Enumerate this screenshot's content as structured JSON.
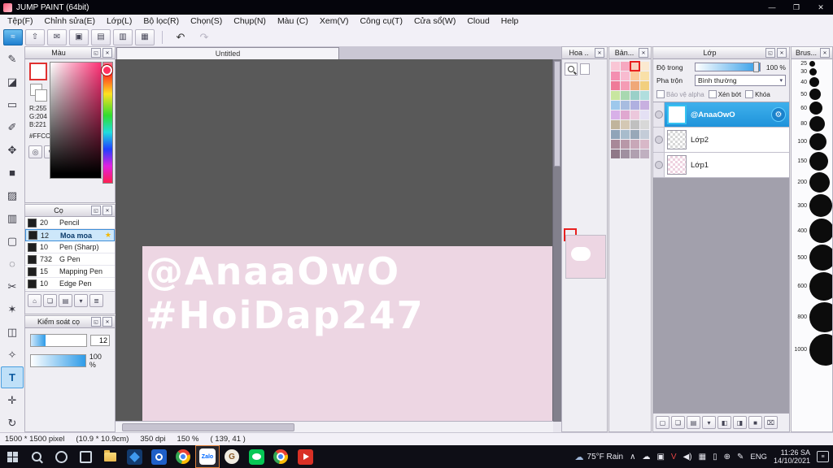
{
  "window": {
    "title": "JUMP PAINT (64bit)",
    "minimize_glyph": "—",
    "maximize_glyph": "❐",
    "close_glyph": "✕"
  },
  "ui": {
    "detach_glyph": "◱",
    "close_glyph": "✕",
    "dropdown_glyph": "▾",
    "accent_blue": "#2F9CE8",
    "selection_red": "#E82020"
  },
  "menubar": {
    "items": [
      {
        "label": "Tệp(F)",
        "name": "tep"
      },
      {
        "label": "Chỉnh sửa(E)",
        "name": "chinh-sua"
      },
      {
        "label": "Lớp(L)",
        "name": "lop"
      },
      {
        "label": "Bộ lọc(R)",
        "name": "bo-loc"
      },
      {
        "label": "Chọn(S)",
        "name": "chon"
      },
      {
        "label": "Chụp(N)",
        "name": "chup"
      },
      {
        "label": "Màu (C)",
        "name": "mau"
      },
      {
        "label": "Xem(V)",
        "name": "xem"
      },
      {
        "label": "Công cụ(T)",
        "name": "cong-cu"
      },
      {
        "label": "Cửa sổ(W)",
        "name": "cua-so"
      },
      {
        "label": "Cloud",
        "name": "cloud"
      },
      {
        "label": "Help",
        "name": "help"
      }
    ]
  },
  "toolbar": {
    "buttons": [
      {
        "name": "paint-mode-button",
        "glyph": "≈",
        "accent": true
      },
      {
        "name": "export-button",
        "glyph": "⇧"
      },
      {
        "name": "comment-button",
        "glyph": "✉"
      },
      {
        "name": "screen-share-button",
        "glyph": "▣"
      },
      {
        "name": "page-button",
        "glyph": "▤"
      },
      {
        "name": "pages-button",
        "glyph": "▥"
      },
      {
        "name": "grid-button",
        "glyph": "▦"
      }
    ],
    "undo_glyph": "↶",
    "redo_glyph": "↷"
  },
  "tools": {
    "items": [
      {
        "name": "pen-tool",
        "glyph": "✎"
      },
      {
        "name": "eraser-tool",
        "glyph": "◪"
      },
      {
        "name": "rect-tool",
        "glyph": "▭"
      },
      {
        "name": "dip-pen-tool",
        "glyph": "✐"
      },
      {
        "name": "move-tool",
        "glyph": "✥"
      },
      {
        "name": "fill-square-tool",
        "glyph": "■"
      },
      {
        "name": "bucket-tool",
        "glyph": "▨"
      },
      {
        "name": "gradient-tool",
        "glyph": "▥"
      },
      {
        "name": "select-rect-tool",
        "glyph": "▢"
      },
      {
        "name": "select-ellipse-tool",
        "glyph": "◌"
      },
      {
        "name": "lasso-tool",
        "glyph": "✂"
      },
      {
        "name": "magic-wand-tool",
        "glyph": "✶"
      },
      {
        "name": "divide-tool",
        "glyph": "◫"
      },
      {
        "name": "eyedropper-tool",
        "glyph": "✧"
      },
      {
        "name": "text-tool",
        "glyph": "T",
        "selected": true
      },
      {
        "name": "hand-tool",
        "glyph": "✛"
      },
      {
        "name": "rotate-tool",
        "glyph": "↻"
      }
    ]
  },
  "color_panel": {
    "title": "Màu",
    "r_label": "R:255",
    "g_label": "G:204",
    "b_label": "B:221",
    "hex": "#FFCCDD",
    "buttons": [
      {
        "name": "color-wheel-button",
        "glyph": "◎"
      },
      {
        "name": "color-history-button",
        "glyph": "↖"
      }
    ]
  },
  "brush_panel": {
    "title": "Cọ",
    "selected_star_glyph": "★",
    "brushes": [
      {
        "size": "20",
        "name": "Pencil"
      },
      {
        "size": "12",
        "name": "Moa moa",
        "selected": true
      },
      {
        "size": "10",
        "name": "Pen (Sharp)"
      },
      {
        "size": "732",
        "name": "G Pen"
      },
      {
        "size": "15",
        "name": "Mapping Pen"
      },
      {
        "size": "10",
        "name": "Edge Pen"
      }
    ],
    "buttons": [
      {
        "name": "brush-home-button",
        "glyph": "⌂"
      },
      {
        "name": "brush-new-button",
        "glyph": "❏"
      },
      {
        "name": "brush-folder-button",
        "glyph": "▤"
      },
      {
        "name": "brush-menu-button",
        "glyph": "▾"
      },
      {
        "name": "brush-list-button",
        "glyph": "≣"
      }
    ]
  },
  "brush_control_panel": {
    "title": "Kiểm soát cọ",
    "size_value": "12",
    "opacity_value": "100 %"
  },
  "canvas": {
    "tab_title": "Untitled",
    "line1": "@AnaaOwO",
    "line2": "#HoiDap247",
    "background": "#EDD6E3",
    "text_color": "#FFFFFF"
  },
  "navigator_panel": {
    "title": "Hoa .."
  },
  "swatches_panel": {
    "title": "Bản...",
    "selected_index": 2,
    "colors": [
      "#f9c6d5",
      "#f6a8c0",
      "#f8d3c0",
      "#fbe9d0",
      "#f48fb1",
      "#f8bbd0",
      "#fbc99b",
      "#f9e0a8",
      "#ef7a98",
      "#f59cb5",
      "#f0a878",
      "#f2cf7e",
      "#c8e6a0",
      "#a8d8b0",
      "#9ad0c8",
      "#b0dede",
      "#9ec8ec",
      "#a8bce0",
      "#b0b0e0",
      "#c8b0e0",
      "#d8b0e8",
      "#e0a8d0",
      "#ecc8dc",
      "#e4e0f4",
      "#c0b49c",
      "#d4c8b4",
      "#c0c0c0",
      "#d8d8d8",
      "#90a4b8",
      "#a8bccc",
      "#98a8b8",
      "#c4ccd8",
      "#a88898",
      "#b898a8",
      "#c8a8b8",
      "#d8b8c8",
      "#907888",
      "#a090a0",
      "#b0a0b0",
      "#c0b0c0"
    ]
  },
  "layers_panel": {
    "title": "Lớp",
    "opacity_label": "Độ trong",
    "opacity_value": "100 %",
    "blend_label": "Pha trộn",
    "blend_value": "Bình thường",
    "protect_alpha_label": "Bảo vệ alpha",
    "clip_label": "Xén bớt",
    "lock_label": "Khóa",
    "gear_glyph": "⚙",
    "layers": [
      {
        "name": "@AnaaOwO",
        "selected": true,
        "thumb": "art"
      },
      {
        "name": "Lớp2",
        "thumb": "checker"
      },
      {
        "name": "Lớp1",
        "thumb": "checker-pink"
      }
    ],
    "buttons": [
      {
        "name": "new-layer-button",
        "glyph": "▢"
      },
      {
        "name": "duplicate-layer-button",
        "glyph": "❏"
      },
      {
        "name": "new-folder-button",
        "glyph": "▤"
      },
      {
        "name": "layer-menu-button",
        "glyph": "▾"
      },
      {
        "name": "merge-layer-button",
        "glyph": "◧"
      },
      {
        "name": "clipping-button",
        "glyph": "◨"
      },
      {
        "name": "fill-layer-button",
        "glyph": "■"
      },
      {
        "name": "delete-layer-button",
        "glyph": "⌧"
      }
    ]
  },
  "brush_size_panel": {
    "title": "Brus...",
    "sizes": [
      "25",
      "30",
      "40",
      "50",
      "60",
      "80",
      "100",
      "150",
      "200",
      "300",
      "400",
      "500",
      "600",
      "800",
      "1000"
    ]
  },
  "statusbar": {
    "size": "1500 * 1500 pixel",
    "dimensions": "(10.9 * 10.9cm)",
    "dpi": "350 dpi",
    "zoom": "150 %",
    "coords": "( 139, 41 )"
  },
  "taskbar": {
    "apps": [
      {
        "name": "photos-app",
        "kind": "photos"
      },
      {
        "name": "camera-app",
        "kind": "camera"
      },
      {
        "name": "chrome",
        "kind": "chrome"
      },
      {
        "name": "zalo",
        "kind": "zalo",
        "label": "Zalo",
        "active": true
      },
      {
        "name": "gimp-app",
        "kind": "gimp",
        "label": "G"
      },
      {
        "name": "line-app",
        "kind": "line"
      },
      {
        "name": "browser-app",
        "kind": "chrome"
      },
      {
        "name": "video-app",
        "kind": "video"
      }
    ],
    "weather": {
      "glyph": "☁",
      "temp": "75°F Rain"
    },
    "tray": [
      {
        "name": "chevron-up-icon",
        "glyph": "∧"
      },
      {
        "name": "onedrive-icon",
        "glyph": "☁"
      },
      {
        "name": "display-icon",
        "glyph": "▣"
      },
      {
        "name": "vlc-icon",
        "glyph": "V",
        "color": "#e64545"
      },
      {
        "name": "speaker-icon",
        "glyph": "◀)"
      },
      {
        "name": "keyboard-icon",
        "glyph": "▦"
      },
      {
        "name": "battery-icon",
        "glyph": "▯"
      },
      {
        "name": "network-icon",
        "glyph": "⊕"
      },
      {
        "name": "pen-icon",
        "glyph": "✎"
      }
    ],
    "language": "ENG",
    "time": "11:26 SA",
    "date": "14/10/2021"
  }
}
